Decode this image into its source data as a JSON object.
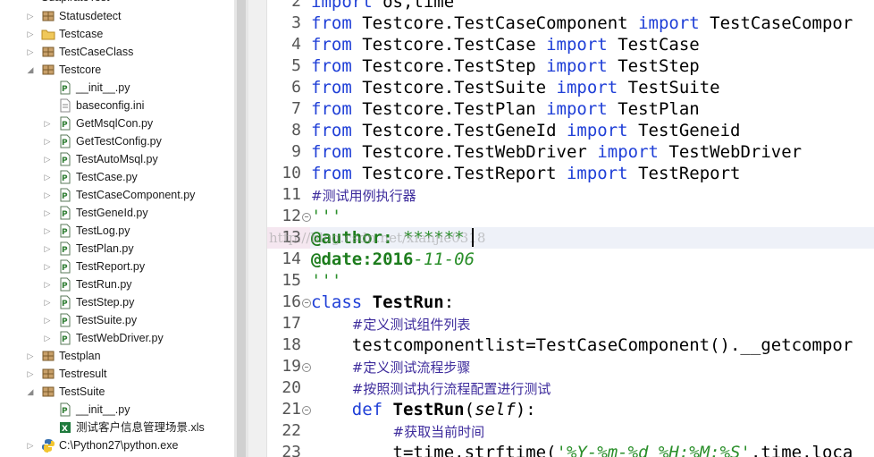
{
  "explorer": {
    "top_partial_label": "SuapirateTest",
    "items": [
      {
        "label": "Statusdetect",
        "indent": 0,
        "kind": "package",
        "expanded": false,
        "arrow": "right"
      },
      {
        "label": "Testcase",
        "indent": 0,
        "kind": "folder",
        "expanded": false,
        "arrow": "right"
      },
      {
        "label": "TestCaseClass",
        "indent": 0,
        "kind": "package",
        "expanded": false,
        "arrow": "right"
      },
      {
        "label": "Testcore",
        "indent": 0,
        "kind": "package",
        "expanded": true,
        "arrow": "down"
      },
      {
        "label": "__init__.py",
        "indent": 1,
        "kind": "pyfile",
        "arrow": "none"
      },
      {
        "label": "baseconfig.ini",
        "indent": 1,
        "kind": "inifile",
        "arrow": "none"
      },
      {
        "label": "GetMsqlCon.py",
        "indent": 1,
        "kind": "pyfile",
        "arrow": "right"
      },
      {
        "label": "GetTestConfig.py",
        "indent": 1,
        "kind": "pyfile",
        "arrow": "right"
      },
      {
        "label": "TestAutoMsql.py",
        "indent": 1,
        "kind": "pyfile",
        "arrow": "right"
      },
      {
        "label": "TestCase.py",
        "indent": 1,
        "kind": "pyfile",
        "arrow": "right"
      },
      {
        "label": "TestCaseComponent.py",
        "indent": 1,
        "kind": "pyfile",
        "arrow": "right"
      },
      {
        "label": "TestGeneId.py",
        "indent": 1,
        "kind": "pyfile",
        "arrow": "right"
      },
      {
        "label": "TestLog.py",
        "indent": 1,
        "kind": "pyfile",
        "arrow": "right"
      },
      {
        "label": "TestPlan.py",
        "indent": 1,
        "kind": "pyfile",
        "arrow": "right"
      },
      {
        "label": "TestReport.py",
        "indent": 1,
        "kind": "pyfile",
        "arrow": "right"
      },
      {
        "label": "TestRun.py",
        "indent": 1,
        "kind": "pyfile",
        "arrow": "right"
      },
      {
        "label": "TestStep.py",
        "indent": 1,
        "kind": "pyfile",
        "arrow": "right"
      },
      {
        "label": "TestSuite.py",
        "indent": 1,
        "kind": "pyfile",
        "arrow": "right"
      },
      {
        "label": "TestWebDriver.py",
        "indent": 1,
        "kind": "pyfile",
        "arrow": "right"
      },
      {
        "label": "Testplan",
        "indent": 0,
        "kind": "package",
        "expanded": false,
        "arrow": "right"
      },
      {
        "label": "Testresult",
        "indent": 0,
        "kind": "package",
        "expanded": false,
        "arrow": "right"
      },
      {
        "label": "TestSuite",
        "indent": 0,
        "kind": "package",
        "expanded": true,
        "arrow": "down"
      },
      {
        "label": "__init__.py",
        "indent": 1,
        "kind": "pyfile",
        "arrow": "none"
      },
      {
        "label": "测试客户信息管理场景.xls",
        "indent": 1,
        "kind": "xlsfile",
        "arrow": "none"
      },
      {
        "label": "C:\\Python27\\python.exe",
        "indent": 0,
        "kind": "python",
        "expanded": false,
        "arrow": "right"
      }
    ]
  },
  "editor": {
    "current_line": "13",
    "watermark": "http://blog.csdn.net/xianjie0318",
    "lines": [
      {
        "n": "2",
        "fold": false,
        "tokens": [
          [
            "kw",
            "import"
          ],
          [
            "p",
            " os,time"
          ]
        ]
      },
      {
        "n": "3",
        "fold": false,
        "tokens": [
          [
            "kw",
            "from"
          ],
          [
            "p",
            " Testcore.TestCaseComponent "
          ],
          [
            "kw",
            "import"
          ],
          [
            "p",
            " TestCaseCompor"
          ]
        ]
      },
      {
        "n": "4",
        "fold": false,
        "tokens": [
          [
            "kw",
            "from"
          ],
          [
            "p",
            " Testcore.TestCase "
          ],
          [
            "kw",
            "import"
          ],
          [
            "p",
            " TestCase"
          ]
        ]
      },
      {
        "n": "5",
        "fold": false,
        "tokens": [
          [
            "kw",
            "from"
          ],
          [
            "p",
            " Testcore.TestStep "
          ],
          [
            "kw",
            "import"
          ],
          [
            "p",
            " TestStep"
          ]
        ]
      },
      {
        "n": "6",
        "fold": false,
        "tokens": [
          [
            "kw",
            "from"
          ],
          [
            "p",
            " Testcore.TestSuite "
          ],
          [
            "kw",
            "import"
          ],
          [
            "p",
            " TestSuite"
          ]
        ]
      },
      {
        "n": "7",
        "fold": false,
        "tokens": [
          [
            "kw",
            "from"
          ],
          [
            "p",
            " Testcore.TestPlan "
          ],
          [
            "kw",
            "import"
          ],
          [
            "p",
            " TestPlan"
          ]
        ]
      },
      {
        "n": "8",
        "fold": false,
        "tokens": [
          [
            "kw",
            "from"
          ],
          [
            "p",
            " Testcore.TestGeneId "
          ],
          [
            "kw",
            "import"
          ],
          [
            "p",
            " TestGeneid"
          ]
        ]
      },
      {
        "n": "9",
        "fold": false,
        "tokens": [
          [
            "kw",
            "from"
          ],
          [
            "p",
            " Testcore.TestWebDriver "
          ],
          [
            "kw",
            "import"
          ],
          [
            "p",
            " TestWebDriver"
          ]
        ]
      },
      {
        "n": "10",
        "fold": false,
        "tokens": [
          [
            "kw",
            "from"
          ],
          [
            "p",
            " Testcore.TestReport "
          ],
          [
            "kw",
            "import"
          ],
          [
            "p",
            " TestReport"
          ]
        ]
      },
      {
        "n": "11",
        "fold": false,
        "tokens": [
          [
            "cm",
            "#测试用例执行器"
          ]
        ]
      },
      {
        "n": "12",
        "fold": true,
        "tokens": [
          [
            "str",
            "'''"
          ]
        ]
      },
      {
        "n": "13",
        "fold": false,
        "tokens": [
          [
            "dec",
            "@author:"
          ],
          [
            "p",
            " "
          ],
          [
            "str",
            "******"
          ]
        ]
      },
      {
        "n": "14",
        "fold": false,
        "tokens": [
          [
            "dec",
            "@date:2016"
          ],
          [
            "str",
            "-11-06"
          ]
        ]
      },
      {
        "n": "15",
        "fold": false,
        "tokens": [
          [
            "str",
            "'''"
          ]
        ]
      },
      {
        "n": "16",
        "fold": true,
        "tokens": [
          [
            "kw",
            "class"
          ],
          [
            "p",
            " "
          ],
          [
            "bold",
            "TestRun"
          ],
          [
            "p",
            ":"
          ]
        ]
      },
      {
        "n": "17",
        "fold": false,
        "tokens": [
          [
            "p",
            "    "
          ],
          [
            "cm",
            "#定义测试组件列表"
          ]
        ]
      },
      {
        "n": "18",
        "fold": false,
        "tokens": [
          [
            "p",
            "    testcomponentlist=TestCaseComponent().__getcompor"
          ]
        ]
      },
      {
        "n": "19",
        "fold": true,
        "tokens": [
          [
            "p",
            "    "
          ],
          [
            "cm",
            "#定义测试流程步骤"
          ]
        ]
      },
      {
        "n": "20",
        "fold": false,
        "tokens": [
          [
            "p",
            "    "
          ],
          [
            "cm",
            "#按照测试执行流程配置进行测试"
          ]
        ]
      },
      {
        "n": "21",
        "fold": true,
        "tokens": [
          [
            "p",
            "    "
          ],
          [
            "kw",
            "def"
          ],
          [
            "p",
            " "
          ],
          [
            "bold",
            "TestRun"
          ],
          [
            "p",
            "("
          ],
          [
            "ital",
            "self"
          ],
          [
            "p",
            "):"
          ]
        ]
      },
      {
        "n": "22",
        "fold": false,
        "tokens": [
          [
            "p",
            "        "
          ],
          [
            "cm",
            "#获取当前时间"
          ]
        ]
      },
      {
        "n": "23",
        "fold": false,
        "tokens": [
          [
            "p",
            "        t=time.strftime("
          ],
          [
            "str",
            "'%Y-%m-%d %H:%M:%S'"
          ],
          [
            "p",
            ",time.loca"
          ]
        ]
      }
    ]
  },
  "colors": {
    "keyword": "#1f3fd7",
    "string": "#2a8f2a",
    "comment": "#3d2b9c",
    "decorator": "#1d7d1d",
    "current_line_bg": "#eef1f8"
  }
}
